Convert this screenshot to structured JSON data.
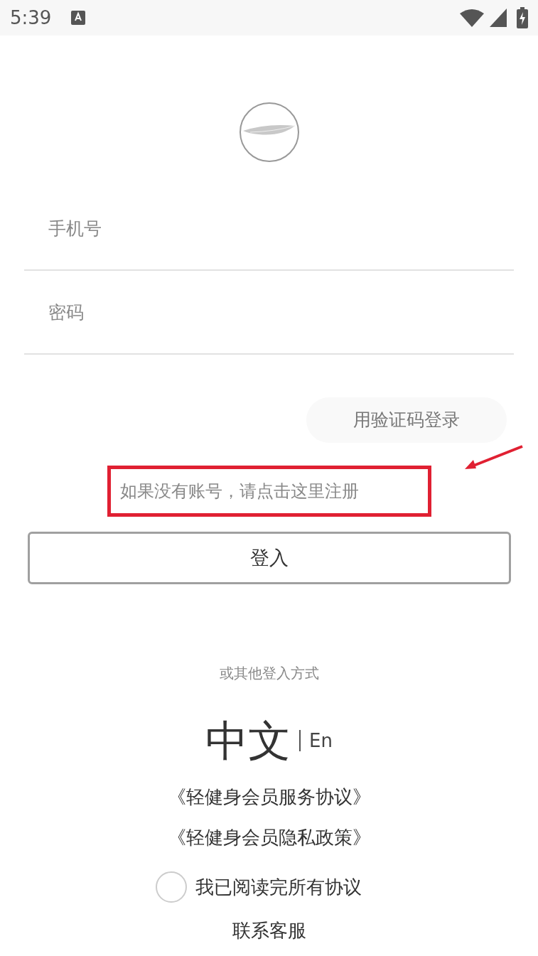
{
  "status_bar": {
    "time": "5:39"
  },
  "fields": [
    {
      "placeholder": "手机号"
    },
    {
      "placeholder": "密码"
    }
  ],
  "sms_login": "用验证码登录",
  "register_link": "如果没有账号，请点击这里注册",
  "login_button": "登入",
  "other_methods": "或其他登入方式",
  "languages": [
    {
      "label": "中文",
      "selected": true
    },
    {
      "label": "En",
      "selected": false
    }
  ],
  "agreements": [
    "《轻健身会员服务协议》",
    "《轻健身会员隐私政策》"
  ],
  "consent": {
    "label": "我已阅读完所有协议",
    "checked": false
  },
  "contact": "联系客服"
}
